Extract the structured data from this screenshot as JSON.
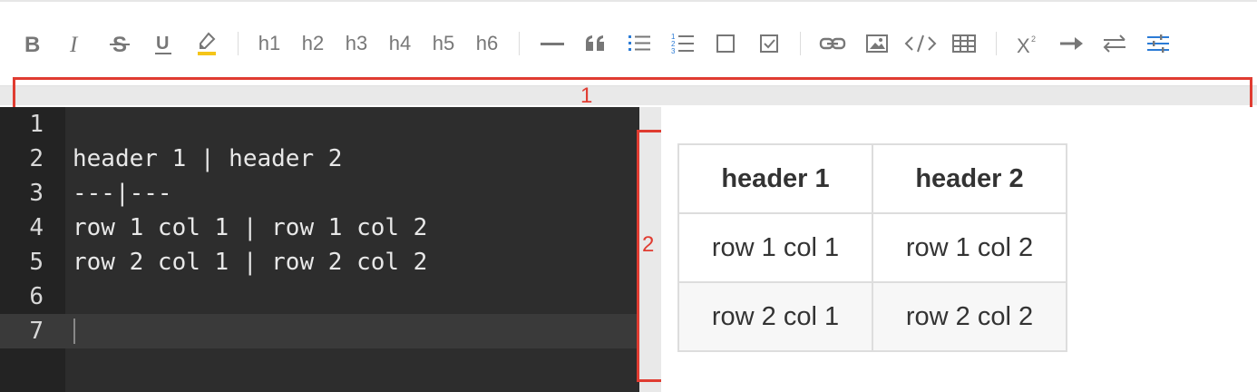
{
  "toolbar": {
    "headings": [
      "h1",
      "h2",
      "h3",
      "h4",
      "h5",
      "h6"
    ],
    "icons": [
      "bold-icon",
      "italic-icon",
      "strikethrough-icon",
      "underline-icon",
      "highlight-icon",
      "horizontal-rule-icon",
      "blockquote-icon",
      "bullet-list-icon",
      "numbered-list-icon",
      "checkbox-icon",
      "checked-checkbox-icon",
      "link-icon",
      "image-icon",
      "code-icon",
      "table-icon",
      "superscript-icon",
      "arrow-right-icon",
      "swap-icon",
      "settings-sliders-icon"
    ],
    "highlight_color": "#f5c518"
  },
  "annotations": {
    "horizontal_bar_label": "1",
    "vertical_bar_label": "2",
    "box_color": "#e03c31"
  },
  "editor": {
    "lines": [
      {
        "num": "1",
        "text": ""
      },
      {
        "num": "2",
        "text": "header 1 | header 2"
      },
      {
        "num": "3",
        "text": "---|---"
      },
      {
        "num": "4",
        "text": "row 1 col 1 | row 1 col 2"
      },
      {
        "num": "5",
        "text": "row 2 col 1 | row 2 col 2"
      },
      {
        "num": "6",
        "text": ""
      },
      {
        "num": "7",
        "text": ""
      }
    ]
  },
  "preview": {
    "headers": [
      "header 1",
      "header 2"
    ],
    "rows": [
      [
        "row 1 col 1",
        "row 1 col 2"
      ],
      [
        "row 2 col 1",
        "row 2 col 2"
      ]
    ]
  }
}
